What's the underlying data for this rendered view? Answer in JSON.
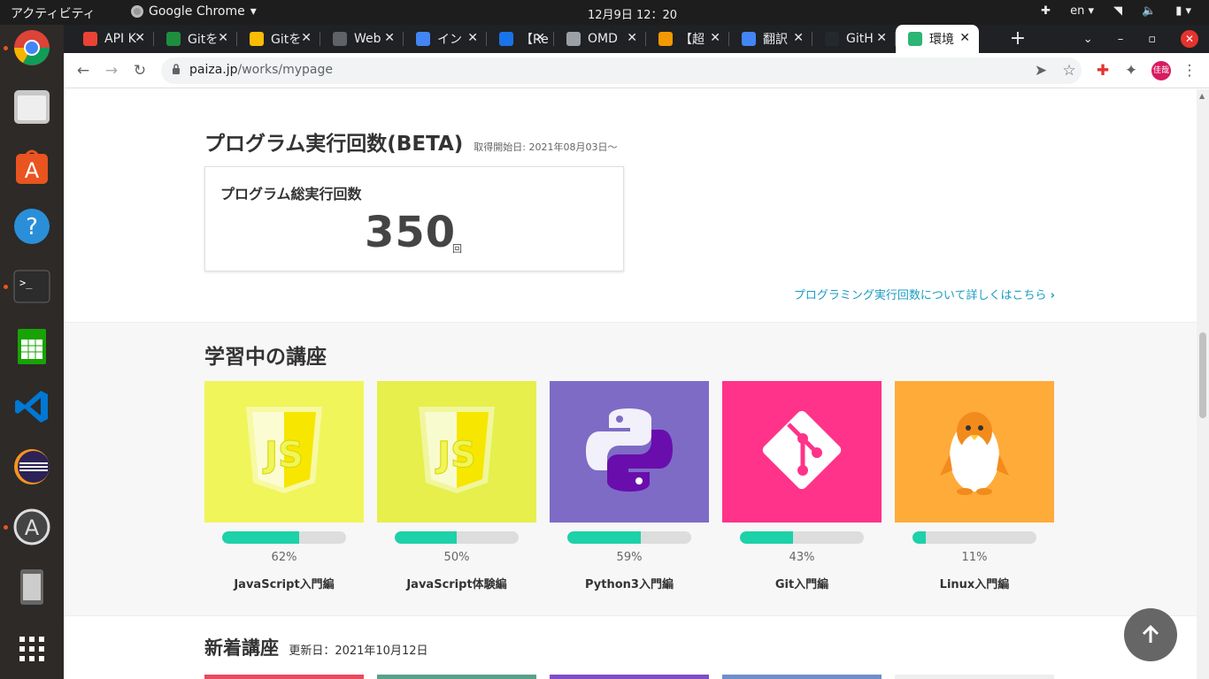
{
  "system": {
    "activities": "アクティビティ",
    "app_name": "Google Chrome",
    "clock": "12月9日  12：20",
    "lang": "en"
  },
  "dock": {
    "items": [
      "chrome-icon",
      "files-icon",
      "software-icon",
      "help-icon",
      "terminal-icon",
      "calc-icon",
      "vscode-icon",
      "eclipse-icon",
      "appcenter-icon",
      "device-icon",
      "app-grid-icon"
    ]
  },
  "tabs": [
    {
      "title": "API K",
      "color": "#ea4335"
    },
    {
      "title": "Gitを",
      "color": "#1e8e3e"
    },
    {
      "title": "Gitを",
      "color": "#fbbc04"
    },
    {
      "title": "Web",
      "color": "#5f6368"
    },
    {
      "title": "イン",
      "color": "#4285f4"
    },
    {
      "title": "【Re",
      "color": "#1a73e8"
    },
    {
      "title": "OMD",
      "color": "#9aa0a6"
    },
    {
      "title": "【超",
      "color": "#f29900"
    },
    {
      "title": "翻訳",
      "color": "#4285f4"
    },
    {
      "title": "GitH",
      "color": "#24292e"
    },
    {
      "title": "環境",
      "color": "#2bb673"
    }
  ],
  "address": {
    "domain": "paiza.jp",
    "path": "/works/mypage"
  },
  "profile": {
    "initials": "佳哉"
  },
  "exec": {
    "title": "プログラム実行回数(BETA)",
    "since": "取得開始日: 2021年08月03日～",
    "card_label": "プログラム総実行回数",
    "count": "350",
    "unit": "回",
    "more_link": "プログラミング実行回数について詳しくはこちら"
  },
  "learning": {
    "title": "学習中の講座",
    "courses": [
      {
        "name": "JavaScript入門編",
        "progress": "62%",
        "progress_value": 62,
        "bg": "#f0f55a",
        "icon": "javascript-icon"
      },
      {
        "name": "JavaScript体験編",
        "progress": "50%",
        "progress_value": 50,
        "bg": "#e6ef4c",
        "icon": "javascript-icon"
      },
      {
        "name": "Python3入門編",
        "progress": "59%",
        "progress_value": 59,
        "bg": "#7e6bc6",
        "icon": "python-icon"
      },
      {
        "name": "Git入門編",
        "progress": "43%",
        "progress_value": 43,
        "bg": "#ff3389",
        "icon": "git-icon"
      },
      {
        "name": "Linux入門編",
        "progress": "11%",
        "progress_value": 11,
        "bg": "#ffab3a",
        "icon": "penguin-icon"
      }
    ]
  },
  "new_courses": {
    "title": "新着講座",
    "updated": "更新日：2021年10月12日"
  }
}
